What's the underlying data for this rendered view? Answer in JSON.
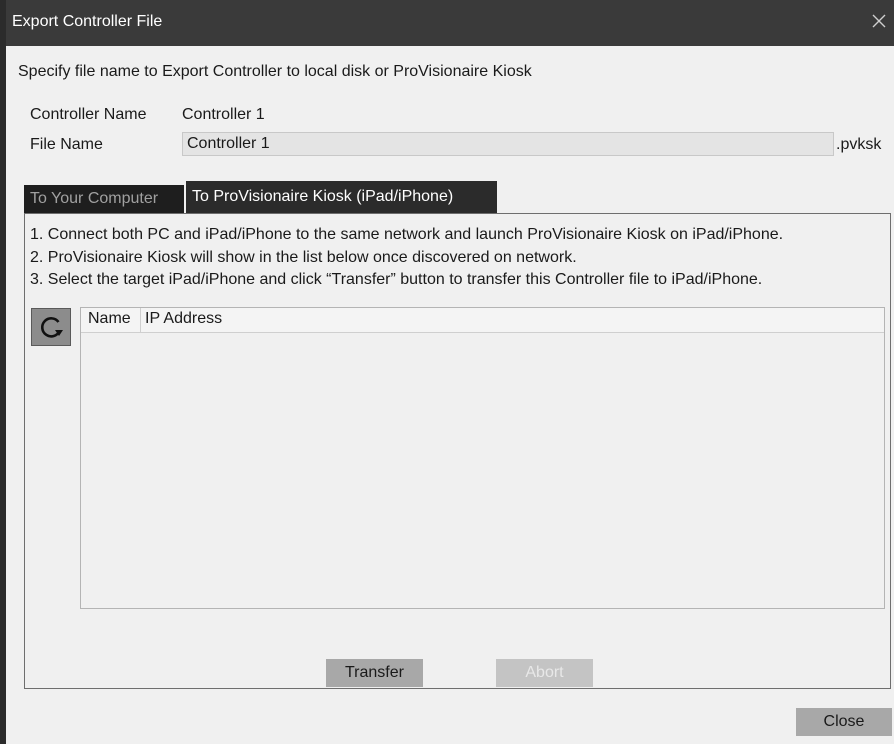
{
  "window": {
    "title": "Export Controller File"
  },
  "description": "Specify file name to Export Controller to local disk or ProVisionaire Kiosk",
  "controller_name": {
    "label": "Controller Name",
    "value": "Controller 1"
  },
  "file_name": {
    "label": "File Name",
    "value": "Controller 1",
    "extension": ".pvksk"
  },
  "tabs": [
    {
      "label": "To Your Computer",
      "active": false
    },
    {
      "label": "To ProVisionaire Kiosk (iPad/iPhone)",
      "active": true
    }
  ],
  "instructions": [
    "1. Connect both PC and iPad/iPhone to the same network and launch ProVisionaire Kiosk on iPad/iPhone.",
    "2. ProVisionaire Kiosk will show in the list below once discovered on network.",
    "3. Select the target iPad/iPhone and click “Transfer” button to transfer this Controller file to iPad/iPhone."
  ],
  "device_list": {
    "columns": [
      "Name",
      "IP Address"
    ],
    "rows": []
  },
  "buttons": {
    "refresh_icon": "refresh-icon",
    "transfer": "Transfer",
    "abort": "Abort",
    "close": "Close"
  },
  "colors": {
    "titlebar": "#3a3a3a",
    "active_tab": "#2b2b2b",
    "inactive_tab": "#1e1e1e",
    "button": "#a8a8a8",
    "disabled_button": "#c4c4c4"
  }
}
